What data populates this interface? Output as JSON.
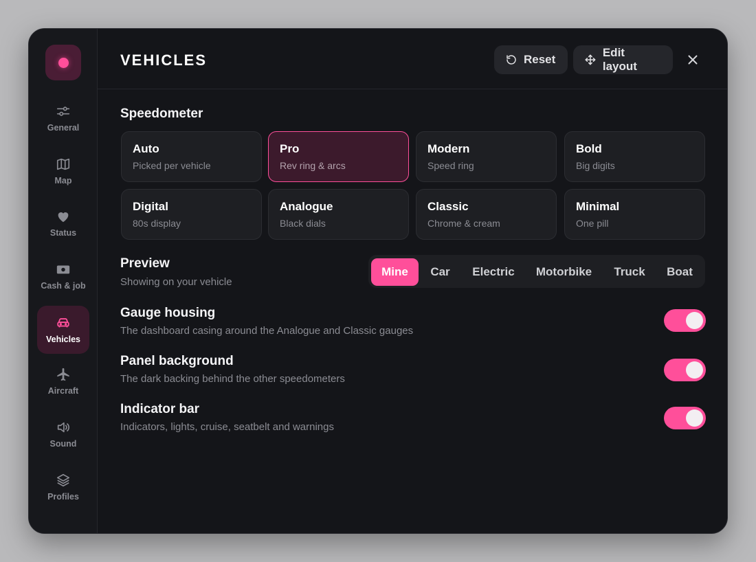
{
  "sidebar": {
    "items": [
      {
        "label": "General",
        "icon": "sliders-icon",
        "active": false
      },
      {
        "label": "Map",
        "icon": "map-icon",
        "active": false
      },
      {
        "label": "Status",
        "icon": "heart-icon",
        "active": false
      },
      {
        "label": "Cash & job",
        "icon": "cash-icon",
        "active": false
      },
      {
        "label": "Vehicles",
        "icon": "car-icon",
        "active": true
      },
      {
        "label": "Aircraft",
        "icon": "plane-icon",
        "active": false
      },
      {
        "label": "Sound",
        "icon": "speaker-icon",
        "active": false
      },
      {
        "label": "Profiles",
        "icon": "layers-icon",
        "active": false
      }
    ]
  },
  "header": {
    "title": "VEHICLES",
    "reset_label": "Reset",
    "edit_layout_label": "Edit layout"
  },
  "speedometer": {
    "title": "Speedometer",
    "options": [
      {
        "title": "Auto",
        "subtitle": "Picked per vehicle",
        "selected": false
      },
      {
        "title": "Pro",
        "subtitle": "Rev ring & arcs",
        "selected": true
      },
      {
        "title": "Modern",
        "subtitle": "Speed ring",
        "selected": false
      },
      {
        "title": "Bold",
        "subtitle": "Big digits",
        "selected": false
      },
      {
        "title": "Digital",
        "subtitle": "80s display",
        "selected": false
      },
      {
        "title": "Analogue",
        "subtitle": "Black dials",
        "selected": false
      },
      {
        "title": "Classic",
        "subtitle": "Chrome & cream",
        "selected": false
      },
      {
        "title": "Minimal",
        "subtitle": "One pill",
        "selected": false
      }
    ]
  },
  "preview": {
    "title": "Preview",
    "subtitle": "Showing on your vehicle",
    "tabs": [
      "Mine",
      "Car",
      "Electric",
      "Motorbike",
      "Truck",
      "Boat"
    ],
    "active_tab": "Mine"
  },
  "settings": [
    {
      "title": "Gauge housing",
      "subtitle": "The dashboard casing around the Analogue and Classic gauges",
      "enabled": true
    },
    {
      "title": "Panel background",
      "subtitle": "The dark backing behind the other speedometers",
      "enabled": true
    },
    {
      "title": "Indicator bar",
      "subtitle": "Indicators, lights, cruise, seatbelt and warnings",
      "enabled": true
    }
  ],
  "colors": {
    "accent": "#ff4f9a",
    "background": "#141519",
    "sidebar": "#17181c",
    "card": "#1e1f23",
    "selected_card": "#3c1a2c"
  }
}
